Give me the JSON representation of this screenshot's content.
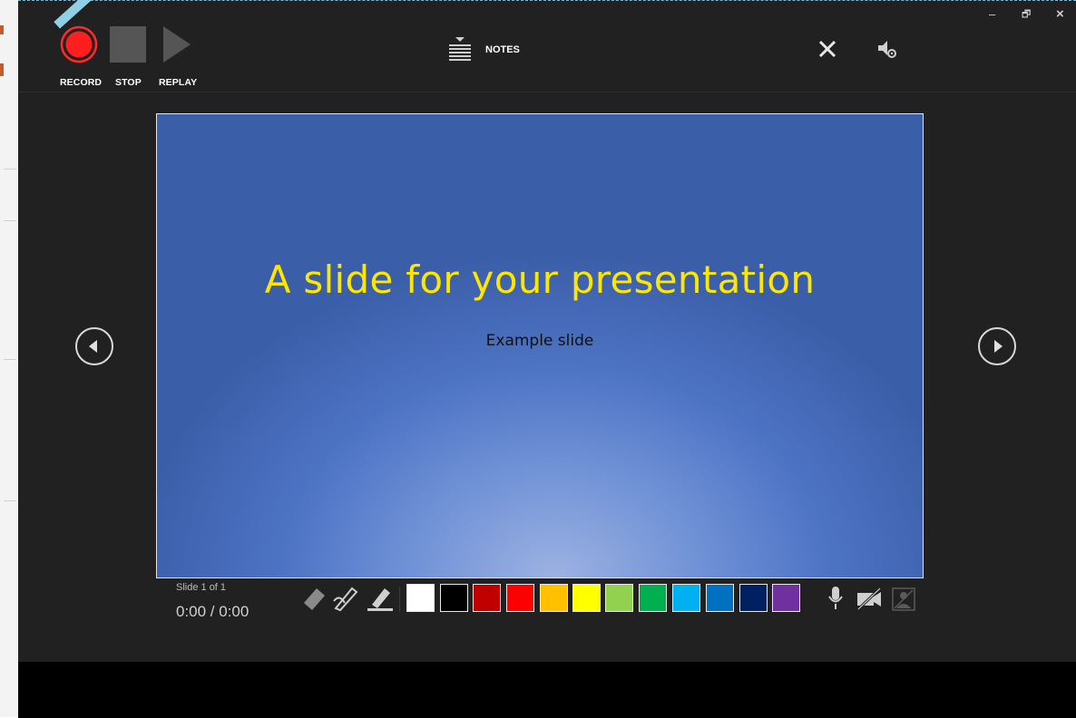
{
  "toolbar": {
    "record_label": "RECORD",
    "stop_label": "STOP",
    "replay_label": "REPLAY",
    "notes_label": "NOTES"
  },
  "window_controls": {
    "minimize": "–",
    "restore": "🗗",
    "close": "×"
  },
  "slide": {
    "title": "A slide for your presentation",
    "subtitle": "Example slide",
    "title_color": "#ffe600"
  },
  "status": {
    "slide_counter": "Slide 1 of 1",
    "timer": "0:00 / 0:00"
  },
  "ink_tools": [
    "eraser-icon",
    "pen-icon",
    "highlighter-icon"
  ],
  "ink_colors": [
    "#ffffff",
    "#000000",
    "#c00000",
    "#ff0000",
    "#ffc000",
    "#ffff00",
    "#92d050",
    "#00b050",
    "#00b0f0",
    "#0070c0",
    "#002060",
    "#7030a0"
  ],
  "media_controls": [
    "microphone-icon",
    "camera-off-icon",
    "camera-preview-off-icon"
  ]
}
